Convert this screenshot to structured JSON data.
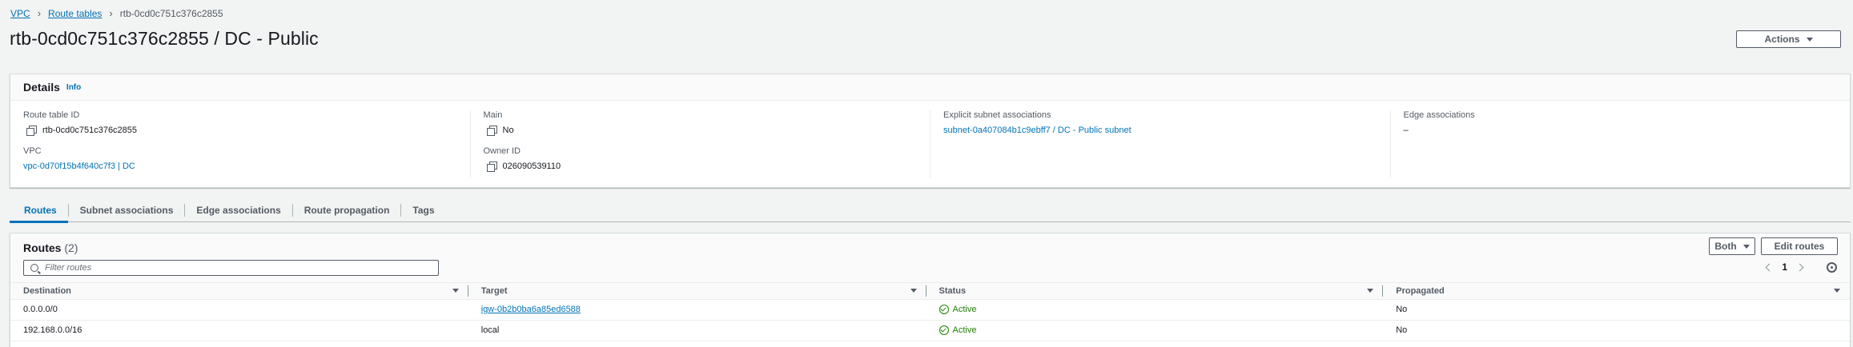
{
  "breadcrumb": {
    "items": [
      "VPC",
      "Route tables"
    ],
    "current": "rtb-0cd0c751c376c2855"
  },
  "page": {
    "title": "rtb-0cd0c751c376c2855 / DC - Public",
    "actions_label": "Actions"
  },
  "details": {
    "title": "Details",
    "info_label": "Info",
    "route_table_id_label": "Route table ID",
    "route_table_id": "rtb-0cd0c751c376c2855",
    "vpc_label": "VPC",
    "vpc": "vpc-0d70f15b4f640c7f3 | DC",
    "main_label": "Main",
    "main": "No",
    "owner_id_label": "Owner ID",
    "owner_id": "026090539110",
    "explicit_label": "Explicit subnet associations",
    "explicit": "subnet-0a407084b1c9ebff7 / DC - Public subnet",
    "edge_label": "Edge associations",
    "edge": "–"
  },
  "tabs": [
    {
      "label": "Routes",
      "active": true
    },
    {
      "label": "Subnet associations"
    },
    {
      "label": "Edge associations"
    },
    {
      "label": "Route propagation"
    },
    {
      "label": "Tags"
    }
  ],
  "routes": {
    "title": "Routes",
    "count": "(2)",
    "filter_placeholder": "Filter routes",
    "both_label": "Both",
    "edit_label": "Edit routes",
    "page": "1",
    "columns": [
      "Destination",
      "Target",
      "Status",
      "Propagated"
    ],
    "rows": [
      {
        "destination": "0.0.0.0/0",
        "target": "igw-0b2b0ba6a85ed6588",
        "status": "Active",
        "propagated": "No"
      },
      {
        "destination": "192.168.0.0/16",
        "target": "local",
        "status": "Active",
        "propagated": "No"
      }
    ]
  },
  "colors": {
    "link": "#0073bb",
    "success": "#1d8102"
  }
}
